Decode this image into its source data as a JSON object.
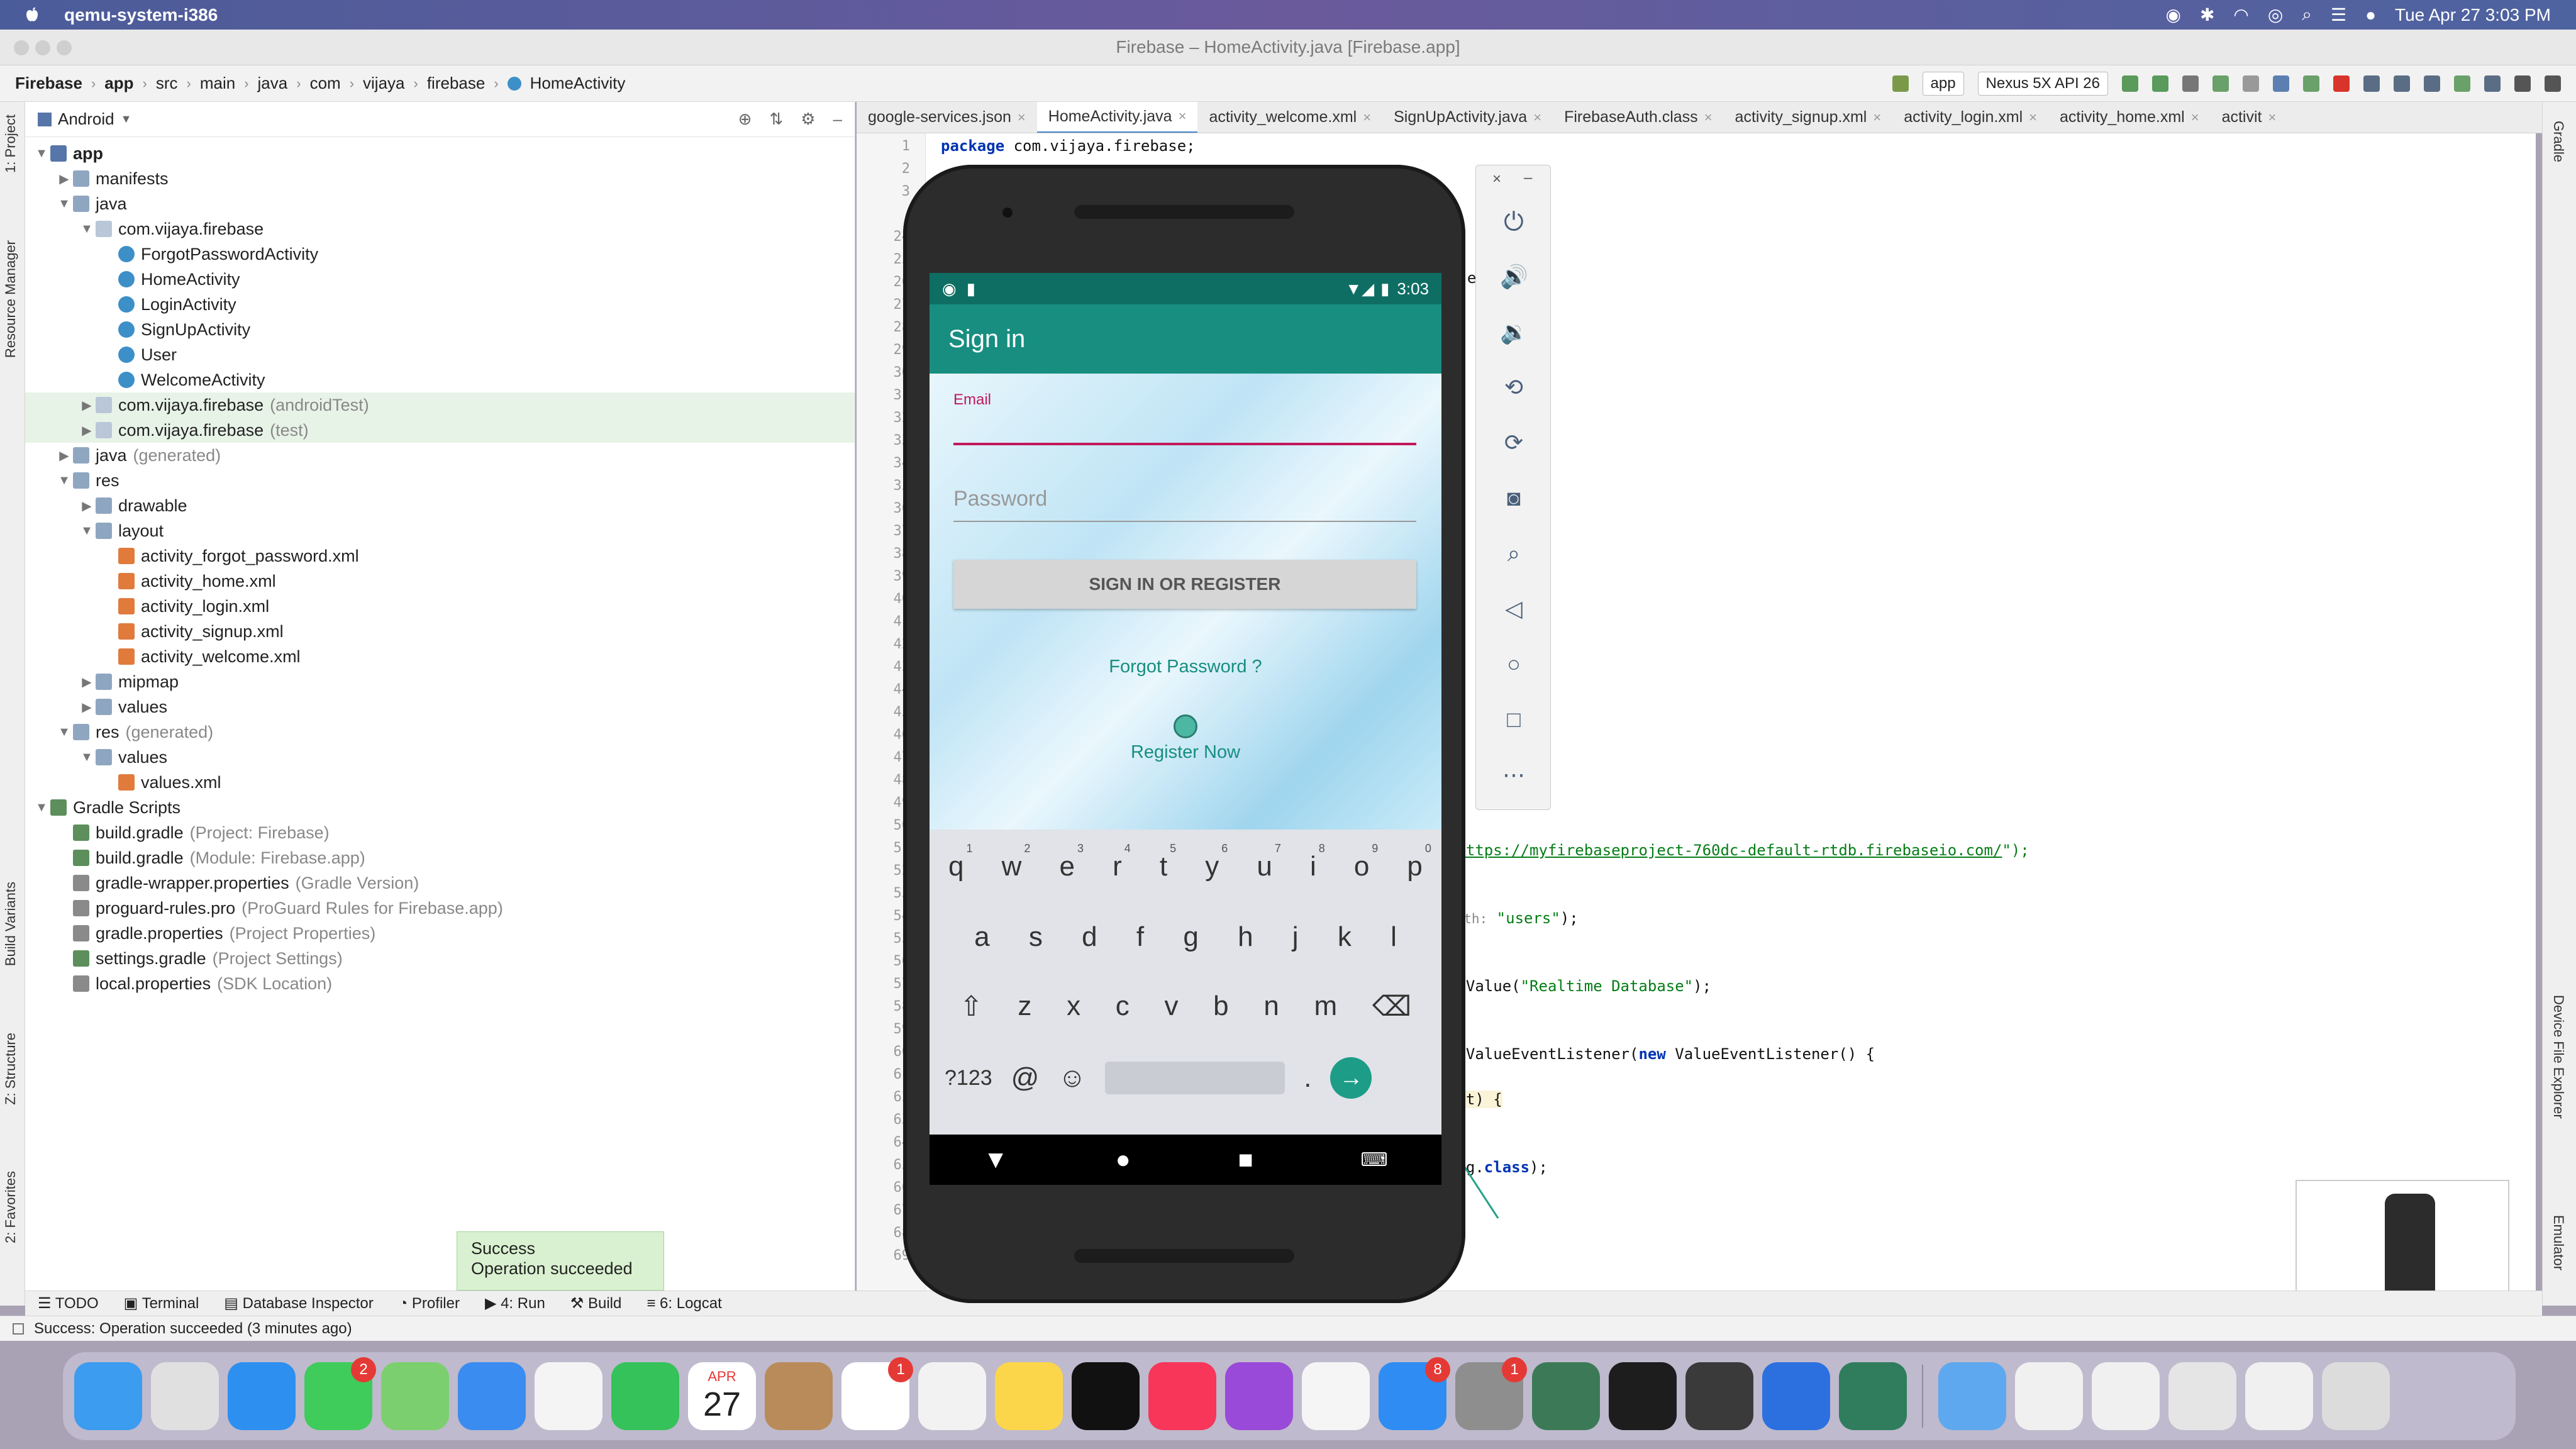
{
  "menubar": {
    "app": "qemu-system-i386",
    "datetime": "Tue Apr 27  3:03 PM"
  },
  "window": {
    "title": "Firebase – HomeActivity.java [Firebase.app]"
  },
  "nav": {
    "crumbs": [
      "Firebase",
      "app",
      "src",
      "main",
      "java",
      "com",
      "vijaya",
      "firebase",
      "HomeActivity"
    ],
    "run_config": "app",
    "device": "Nexus 5X API 26"
  },
  "left_strip": {
    "project": "1: Project",
    "resource": "Resource Manager",
    "variants": "Build Variants",
    "structure": "Z: Structure",
    "favorites": "2: Favorites"
  },
  "right_strip": {
    "gradle": "Gradle",
    "device_explorer": "Device File Explorer",
    "emulator": "Emulator"
  },
  "project": {
    "view": "Android",
    "tree": [
      {
        "t": "app",
        "sfx": "",
        "icon": "mod",
        "d": 0,
        "a": "▼",
        "bold": true
      },
      {
        "t": "manifests",
        "sfx": "",
        "icon": "folder",
        "d": 1,
        "a": "▶"
      },
      {
        "t": "java",
        "sfx": "",
        "icon": "folder",
        "d": 1,
        "a": "▼"
      },
      {
        "t": "com.vijaya.firebase",
        "sfx": "",
        "icon": "pkg",
        "d": 2,
        "a": "▼"
      },
      {
        "t": "ForgotPasswordActivity",
        "sfx": "",
        "icon": "cls",
        "d": 3,
        "a": ""
      },
      {
        "t": "HomeActivity",
        "sfx": "",
        "icon": "cls",
        "d": 3,
        "a": ""
      },
      {
        "t": "LoginActivity",
        "sfx": "",
        "icon": "cls",
        "d": 3,
        "a": ""
      },
      {
        "t": "SignUpActivity",
        "sfx": "",
        "icon": "cls",
        "d": 3,
        "a": ""
      },
      {
        "t": "User",
        "sfx": "",
        "icon": "cls",
        "d": 3,
        "a": ""
      },
      {
        "t": "WelcomeActivity",
        "sfx": "",
        "icon": "cls",
        "d": 3,
        "a": ""
      },
      {
        "t": "com.vijaya.firebase",
        "sfx": "(androidTest)",
        "icon": "pkg",
        "d": 2,
        "a": "▶",
        "hl": true
      },
      {
        "t": "com.vijaya.firebase",
        "sfx": "(test)",
        "icon": "pkg",
        "d": 2,
        "a": "▶",
        "hl": true
      },
      {
        "t": "java",
        "sfx": "(generated)",
        "icon": "folder",
        "d": 1,
        "a": "▶"
      },
      {
        "t": "res",
        "sfx": "",
        "icon": "folder",
        "d": 1,
        "a": "▼"
      },
      {
        "t": "drawable",
        "sfx": "",
        "icon": "folder",
        "d": 2,
        "a": "▶"
      },
      {
        "t": "layout",
        "sfx": "",
        "icon": "folder",
        "d": 2,
        "a": "▼"
      },
      {
        "t": "activity_forgot_password.xml",
        "sfx": "",
        "icon": "xml",
        "d": 3,
        "a": ""
      },
      {
        "t": "activity_home.xml",
        "sfx": "",
        "icon": "xml",
        "d": 3,
        "a": ""
      },
      {
        "t": "activity_login.xml",
        "sfx": "",
        "icon": "xml",
        "d": 3,
        "a": ""
      },
      {
        "t": "activity_signup.xml",
        "sfx": "",
        "icon": "xml",
        "d": 3,
        "a": ""
      },
      {
        "t": "activity_welcome.xml",
        "sfx": "",
        "icon": "xml",
        "d": 3,
        "a": ""
      },
      {
        "t": "mipmap",
        "sfx": "",
        "icon": "folder",
        "d": 2,
        "a": "▶"
      },
      {
        "t": "values",
        "sfx": "",
        "icon": "folder",
        "d": 2,
        "a": "▶"
      },
      {
        "t": "res",
        "sfx": "(generated)",
        "icon": "folder",
        "d": 1,
        "a": "▼"
      },
      {
        "t": "values",
        "sfx": "",
        "icon": "folder",
        "d": 2,
        "a": "▼"
      },
      {
        "t": "values.xml",
        "sfx": "",
        "icon": "xml",
        "d": 3,
        "a": ""
      },
      {
        "t": "Gradle Scripts",
        "sfx": "",
        "icon": "grd",
        "d": 0,
        "a": "▼"
      },
      {
        "t": "build.gradle",
        "sfx": "(Project: Firebase)",
        "icon": "grd",
        "d": 1,
        "a": ""
      },
      {
        "t": "build.gradle",
        "sfx": "(Module: Firebase.app)",
        "icon": "grd",
        "d": 1,
        "a": ""
      },
      {
        "t": "gradle-wrapper.properties",
        "sfx": "(Gradle Version)",
        "icon": "prop",
        "d": 1,
        "a": ""
      },
      {
        "t": "proguard-rules.pro",
        "sfx": "(ProGuard Rules for Firebase.app)",
        "icon": "prop",
        "d": 1,
        "a": ""
      },
      {
        "t": "gradle.properties",
        "sfx": "(Project Properties)",
        "icon": "prop",
        "d": 1,
        "a": ""
      },
      {
        "t": "settings.gradle",
        "sfx": "(Project Settings)",
        "icon": "grd",
        "d": 1,
        "a": ""
      },
      {
        "t": "local.properties",
        "sfx": "(SDK Location)",
        "icon": "prop",
        "d": 1,
        "a": ""
      }
    ]
  },
  "tabs": [
    {
      "label": "google-services.json",
      "active": false
    },
    {
      "label": "HomeActivity.java",
      "active": true
    },
    {
      "label": "activity_welcome.xml",
      "active": false
    },
    {
      "label": "SignUpActivity.java",
      "active": false
    },
    {
      "label": "FirebaseAuth.class",
      "active": false
    },
    {
      "label": "activity_signup.xml",
      "active": false
    },
    {
      "label": "activity_login.xml",
      "active": false
    },
    {
      "label": "activity_home.xml",
      "active": false
    },
    {
      "label": "activit",
      "active": false
    }
  ],
  "editor": {
    "line_numbers": [
      "1",
      "2",
      "3",
      "",
      "24",
      "25",
      "26",
      "27",
      "28",
      "29",
      "30",
      "31",
      "32",
      "33",
      "34",
      "35",
      "36",
      "37",
      "38",
      "39",
      "40",
      "41",
      "42",
      "43",
      "44",
      "45",
      "46",
      "47",
      "48",
      "49",
      "50",
      "51",
      "52",
      "53",
      "54",
      "55",
      "56",
      "57",
      "58",
      "59",
      "60",
      "61",
      "62",
      "63",
      "64",
      "65",
      "66",
      "67",
      "68",
      "69"
    ],
    "package_kw": "package",
    "package_name": " com.vijaya.firebase;",
    "frag_25": "tS",
    "frag_25b": "e();",
    "frag_50a": "\"",
    "frag_50_url": "https://myfirebaseproject-760dc-default-rtdb.firebaseio.com/",
    "frag_50b": "\");",
    "frag_53_hint": "path:",
    "frag_53_str": "\"users\"",
    "frag_53_end": ");",
    "frag_56a": "etValue(",
    "frag_56_str": "\"Realtime Database\"",
    "frag_56b": ");",
    "frag_59a": "ddValueEventListener(",
    "frag_59_kw": "new",
    "frag_59b": " ValueEventListener() {",
    "frag_61": "hot) {",
    "frag_64": "ing.",
    "frag_64_kw": "class",
    "frag_64b": ");"
  },
  "bottom_tools": {
    "todo": "TODO",
    "terminal": "Terminal",
    "db": "Database Inspector",
    "profiler": "Profiler",
    "run": "4: Run",
    "build": "Build",
    "logcat": "6: Logcat"
  },
  "status": {
    "text": "Success: Operation succeeded (3 minutes ago)"
  },
  "toast": {
    "title": "Success",
    "body": "Operation succeeded"
  },
  "phone": {
    "time": "3:03",
    "appbar_title": "Sign in",
    "email_label": "Email",
    "password_hint": "Password",
    "signin_button": "SIGN IN OR REGISTER",
    "forgot": "Forgot Password ?",
    "register": "Register Now",
    "kb_row1": [
      "q",
      "w",
      "e",
      "r",
      "t",
      "y",
      "u",
      "i",
      "o",
      "p"
    ],
    "kb_row1_nums": [
      "1",
      "2",
      "3",
      "4",
      "5",
      "6",
      "7",
      "8",
      "9",
      "0"
    ],
    "kb_row2": [
      "a",
      "s",
      "d",
      "f",
      "g",
      "h",
      "j",
      "k",
      "l"
    ],
    "kb_row3": [
      "z",
      "x",
      "c",
      "v",
      "b",
      "n",
      "m"
    ],
    "kb_sym": "?123",
    "kb_at": "@",
    "kb_dot": "."
  },
  "dock": {
    "apps": [
      {
        "name": "finder",
        "color": "#3b9cf0"
      },
      {
        "name": "launchpad",
        "color": "#e0e0e0"
      },
      {
        "name": "safari",
        "color": "#2d8ff0"
      },
      {
        "name": "messages",
        "color": "#3fcc5a",
        "badge": "2"
      },
      {
        "name": "maps",
        "color": "#7ccf6e"
      },
      {
        "name": "mail",
        "color": "#3a8cf0"
      },
      {
        "name": "photos",
        "color": "#f4f4f4"
      },
      {
        "name": "facetime",
        "color": "#36c25a"
      },
      {
        "name": "calendar",
        "color": "#ffffff"
      },
      {
        "name": "contacts",
        "color": "#b98b5a"
      },
      {
        "name": "reminders",
        "color": "#ffffff",
        "badge": "1"
      },
      {
        "name": "chrome",
        "color": "#f2f2f2"
      },
      {
        "name": "notes",
        "color": "#fcd64a"
      },
      {
        "name": "tv",
        "color": "#111111"
      },
      {
        "name": "music",
        "color": "#f7365a"
      },
      {
        "name": "podcasts",
        "color": "#9a4ad8"
      },
      {
        "name": "news",
        "color": "#f5f5f5"
      },
      {
        "name": "app-store",
        "color": "#2f8cf3",
        "badge": "8"
      },
      {
        "name": "system-preferences",
        "color": "#8e8e8e",
        "badge": "1"
      },
      {
        "name": "android-studio",
        "color": "#3c7a57"
      },
      {
        "name": "terminal",
        "color": "#1d1d1d"
      },
      {
        "name": "sublime",
        "color": "#3a3a3a"
      },
      {
        "name": "xcode-tools",
        "color": "#2c70e0"
      },
      {
        "name": "emulator-app",
        "color": "#2f7d5d"
      },
      {
        "name": "downloads",
        "color": "#5ea8ef"
      },
      {
        "name": "window-1",
        "color": "#f0f0f0"
      },
      {
        "name": "window-2",
        "color": "#f0f0f0"
      },
      {
        "name": "window-3",
        "color": "#e5e5e5"
      },
      {
        "name": "window-4",
        "color": "#f0f0f0"
      },
      {
        "name": "trash",
        "color": "#dcdcdc"
      }
    ],
    "calendar_month": "APR",
    "calendar_day": "27"
  }
}
